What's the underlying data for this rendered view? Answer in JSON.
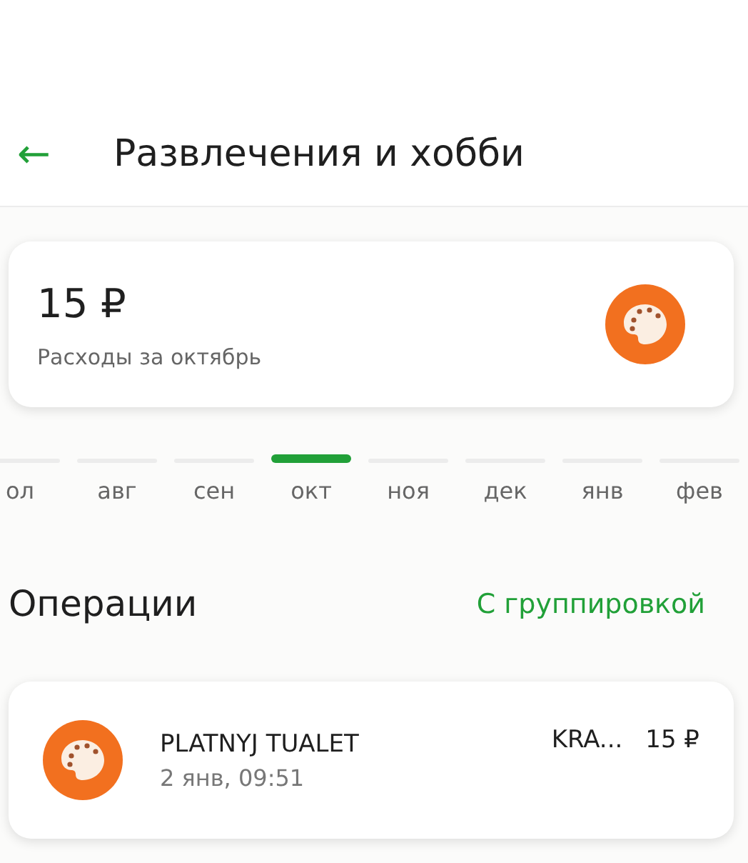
{
  "header": {
    "back": "←",
    "title": "Развлечения и хобби"
  },
  "summary": {
    "amount": "15 ₽",
    "caption": "Расходы за октябрь"
  },
  "months": [
    {
      "label": "ол",
      "selected": false
    },
    {
      "label": "авг",
      "selected": false
    },
    {
      "label": "сен",
      "selected": false
    },
    {
      "label": "окт",
      "selected": true
    },
    {
      "label": "ноя",
      "selected": false
    },
    {
      "label": "дек",
      "selected": false
    },
    {
      "label": "янв",
      "selected": false
    },
    {
      "label": "фев",
      "selected": false
    }
  ],
  "operations": {
    "title": "Операции",
    "grouping": "С группировкой",
    "items": [
      {
        "name": "PLATNYJ TUALET",
        "date": "2 янв, 09:51",
        "place": "KRA...",
        "amount": "15 ₽"
      }
    ]
  }
}
